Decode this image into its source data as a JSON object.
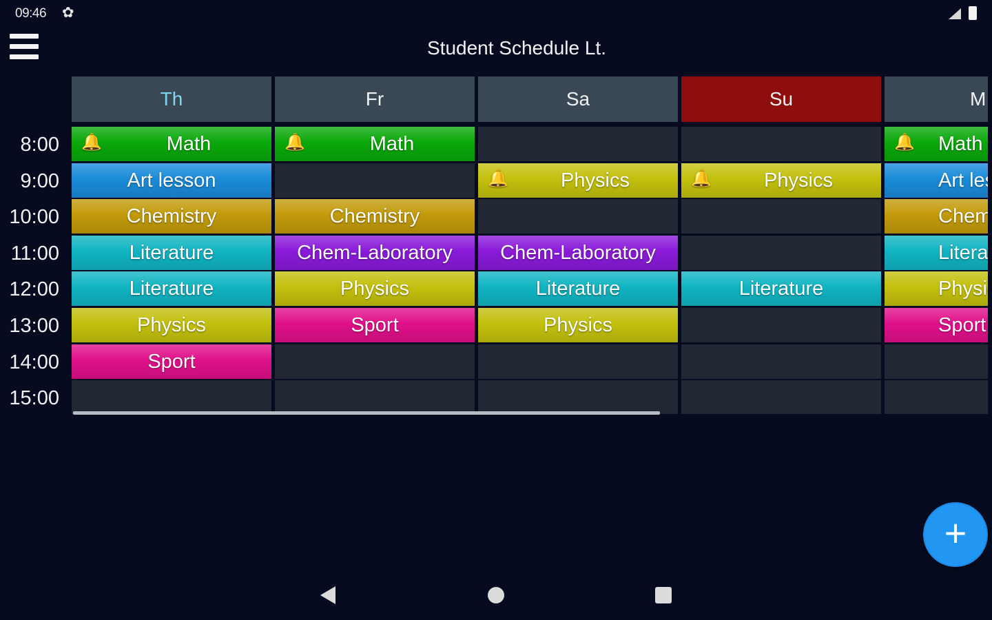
{
  "status_bar": {
    "time": "09:46",
    "settings_glyph": "✿"
  },
  "app": {
    "title": "Student Schedule Lt."
  },
  "times": [
    "8:00",
    "9:00",
    "10:00",
    "11:00",
    "12:00",
    "13:00",
    "14:00",
    "15:00"
  ],
  "days": [
    {
      "label": "Th",
      "style": "today",
      "cells": [
        {
          "name": "Math",
          "color": "#0aa80a",
          "bell": true
        },
        {
          "name": "Art lesson",
          "color": "#1a8bd9",
          "bell": false
        },
        {
          "name": "Chemistry",
          "color": "#c29a0a",
          "bell": false
        },
        {
          "name": "Literature",
          "color": "#10b4c2",
          "bell": false
        },
        {
          "name": "Literature",
          "color": "#10b4c2",
          "bell": false
        },
        {
          "name": "Physics",
          "color": "#c3c00d",
          "bell": false
        },
        {
          "name": "Sport",
          "color": "#e0108a",
          "bell": false
        },
        {
          "name": "",
          "color": "",
          "bell": false
        }
      ]
    },
    {
      "label": "Fr",
      "style": "",
      "cells": [
        {
          "name": "Math",
          "color": "#0aa80a",
          "bell": true
        },
        {
          "name": "",
          "color": "",
          "bell": false
        },
        {
          "name": "Chemistry",
          "color": "#c29a0a",
          "bell": false
        },
        {
          "name": "Chem-Laboratory",
          "color": "#8a1ad9",
          "bell": false
        },
        {
          "name": "Physics",
          "color": "#c3c00d",
          "bell": false
        },
        {
          "name": "Sport",
          "color": "#e0108a",
          "bell": false
        },
        {
          "name": "",
          "color": "",
          "bell": false
        },
        {
          "name": "",
          "color": "",
          "bell": false
        }
      ]
    },
    {
      "label": "Sa",
      "style": "",
      "cells": [
        {
          "name": "",
          "color": "",
          "bell": false
        },
        {
          "name": "Physics",
          "color": "#c3c00d",
          "bell": true
        },
        {
          "name": "",
          "color": "",
          "bell": false
        },
        {
          "name": "Chem-Laboratory",
          "color": "#8a1ad9",
          "bell": false
        },
        {
          "name": "Literature",
          "color": "#10b4c2",
          "bell": false
        },
        {
          "name": "Physics",
          "color": "#c3c00d",
          "bell": false
        },
        {
          "name": "",
          "color": "",
          "bell": false
        },
        {
          "name": "",
          "color": "",
          "bell": false
        }
      ]
    },
    {
      "label": "Su",
      "style": "weekend",
      "cells": [
        {
          "name": "",
          "color": "",
          "bell": false
        },
        {
          "name": "Physics",
          "color": "#c3c00d",
          "bell": true
        },
        {
          "name": "",
          "color": "",
          "bell": false
        },
        {
          "name": "",
          "color": "",
          "bell": false
        },
        {
          "name": "Literature",
          "color": "#10b4c2",
          "bell": false
        },
        {
          "name": "",
          "color": "",
          "bell": false
        },
        {
          "name": "",
          "color": "",
          "bell": false
        },
        {
          "name": "",
          "color": "",
          "bell": false
        }
      ]
    },
    {
      "label": "M",
      "style": "",
      "cells": [
        {
          "name": "Math",
          "color": "#0aa80a",
          "bell": true
        },
        {
          "name": "Art lesson",
          "color": "#1a8bd9",
          "bell": false
        },
        {
          "name": "Chemistry",
          "color": "#c29a0a",
          "bell": false
        },
        {
          "name": "Literature",
          "color": "#10b4c2",
          "bell": false
        },
        {
          "name": "Physics",
          "color": "#c3c00d",
          "bell": false
        },
        {
          "name": "Sport",
          "color": "#e0108a",
          "bell": false
        },
        {
          "name": "",
          "color": "",
          "bell": false
        },
        {
          "name": "",
          "color": "",
          "bell": false
        }
      ]
    }
  ],
  "fab": {
    "glyph": "+"
  },
  "icons": {
    "bell": "🔔"
  }
}
